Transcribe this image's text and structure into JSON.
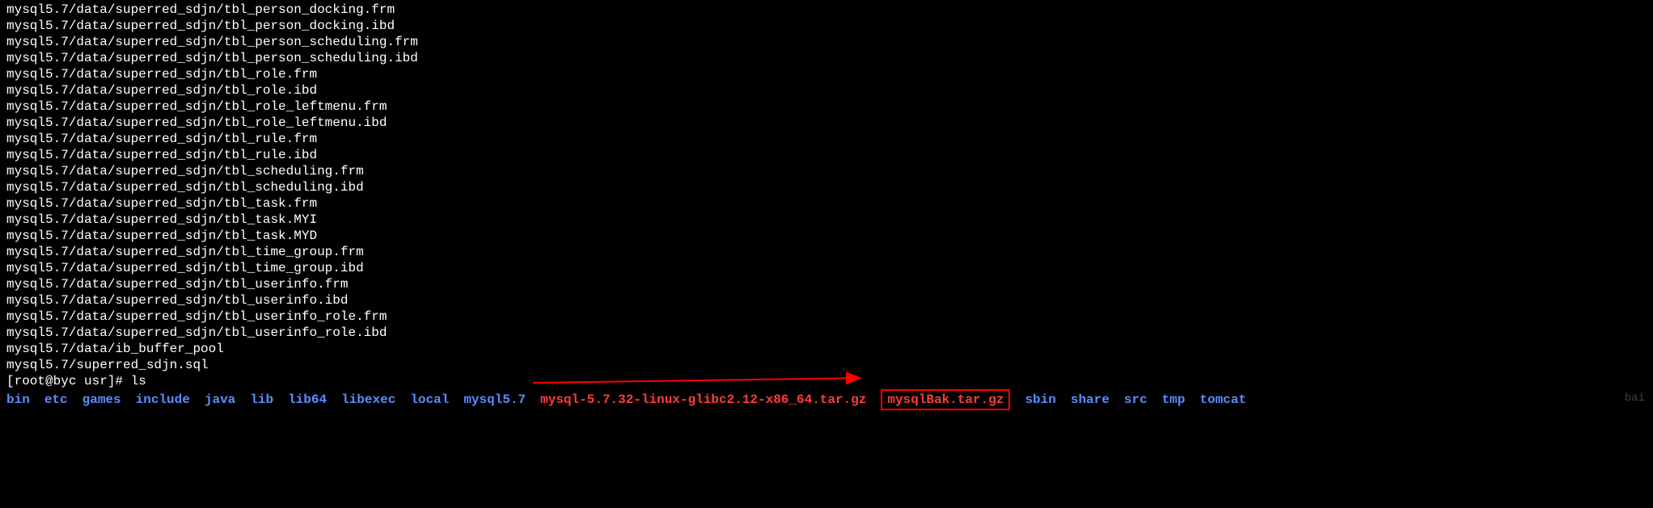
{
  "terminal_output_lines": [
    "mysql5.7/data/superred_sdjn/tbl_person_docking.frm",
    "mysql5.7/data/superred_sdjn/tbl_person_docking.ibd",
    "mysql5.7/data/superred_sdjn/tbl_person_scheduling.frm",
    "mysql5.7/data/superred_sdjn/tbl_person_scheduling.ibd",
    "mysql5.7/data/superred_sdjn/tbl_role.frm",
    "mysql5.7/data/superred_sdjn/tbl_role.ibd",
    "mysql5.7/data/superred_sdjn/tbl_role_leftmenu.frm",
    "mysql5.7/data/superred_sdjn/tbl_role_leftmenu.ibd",
    "mysql5.7/data/superred_sdjn/tbl_rule.frm",
    "mysql5.7/data/superred_sdjn/tbl_rule.ibd",
    "mysql5.7/data/superred_sdjn/tbl_scheduling.frm",
    "mysql5.7/data/superred_sdjn/tbl_scheduling.ibd",
    "mysql5.7/data/superred_sdjn/tbl_task.frm",
    "mysql5.7/data/superred_sdjn/tbl_task.MYI",
    "mysql5.7/data/superred_sdjn/tbl_task.MYD",
    "mysql5.7/data/superred_sdjn/tbl_time_group.frm",
    "mysql5.7/data/superred_sdjn/tbl_time_group.ibd",
    "mysql5.7/data/superred_sdjn/tbl_userinfo.frm",
    "mysql5.7/data/superred_sdjn/tbl_userinfo.ibd",
    "mysql5.7/data/superred_sdjn/tbl_userinfo_role.frm",
    "mysql5.7/data/superred_sdjn/tbl_userinfo_role.ibd",
    "mysql5.7/data/ib_buffer_pool",
    "mysql5.7/superred_sdjn.sql"
  ],
  "prompt_line": "[root@byc usr]# ls",
  "ls_items": [
    {
      "name": "bin",
      "type": "dir"
    },
    {
      "name": "etc",
      "type": "dir"
    },
    {
      "name": "games",
      "type": "dir"
    },
    {
      "name": "include",
      "type": "dir"
    },
    {
      "name": "java",
      "type": "dir"
    },
    {
      "name": "lib",
      "type": "dir"
    },
    {
      "name": "lib64",
      "type": "dir"
    },
    {
      "name": "libexec",
      "type": "dir"
    },
    {
      "name": "local",
      "type": "dir"
    },
    {
      "name": "mysql5.7",
      "type": "dir"
    },
    {
      "name": "mysql-5.7.32-linux-glibc2.12-x86_64.tar.gz",
      "type": "archive"
    },
    {
      "name": "mysqlBak.tar.gz",
      "type": "archive",
      "highlighted": true
    },
    {
      "name": "sbin",
      "type": "dir"
    },
    {
      "name": "share",
      "type": "dir"
    },
    {
      "name": "src",
      "type": "dir"
    },
    {
      "name": "tmp",
      "type": "dir"
    },
    {
      "name": "tomcat",
      "type": "dir"
    }
  ],
  "colors": {
    "background": "#000000",
    "text": "#ffffff",
    "directory": "#5b8cff",
    "archive": "#ff3b3b",
    "highlight_box": "#ff0000",
    "arrow": "#ff0000"
  },
  "watermark": "bai"
}
